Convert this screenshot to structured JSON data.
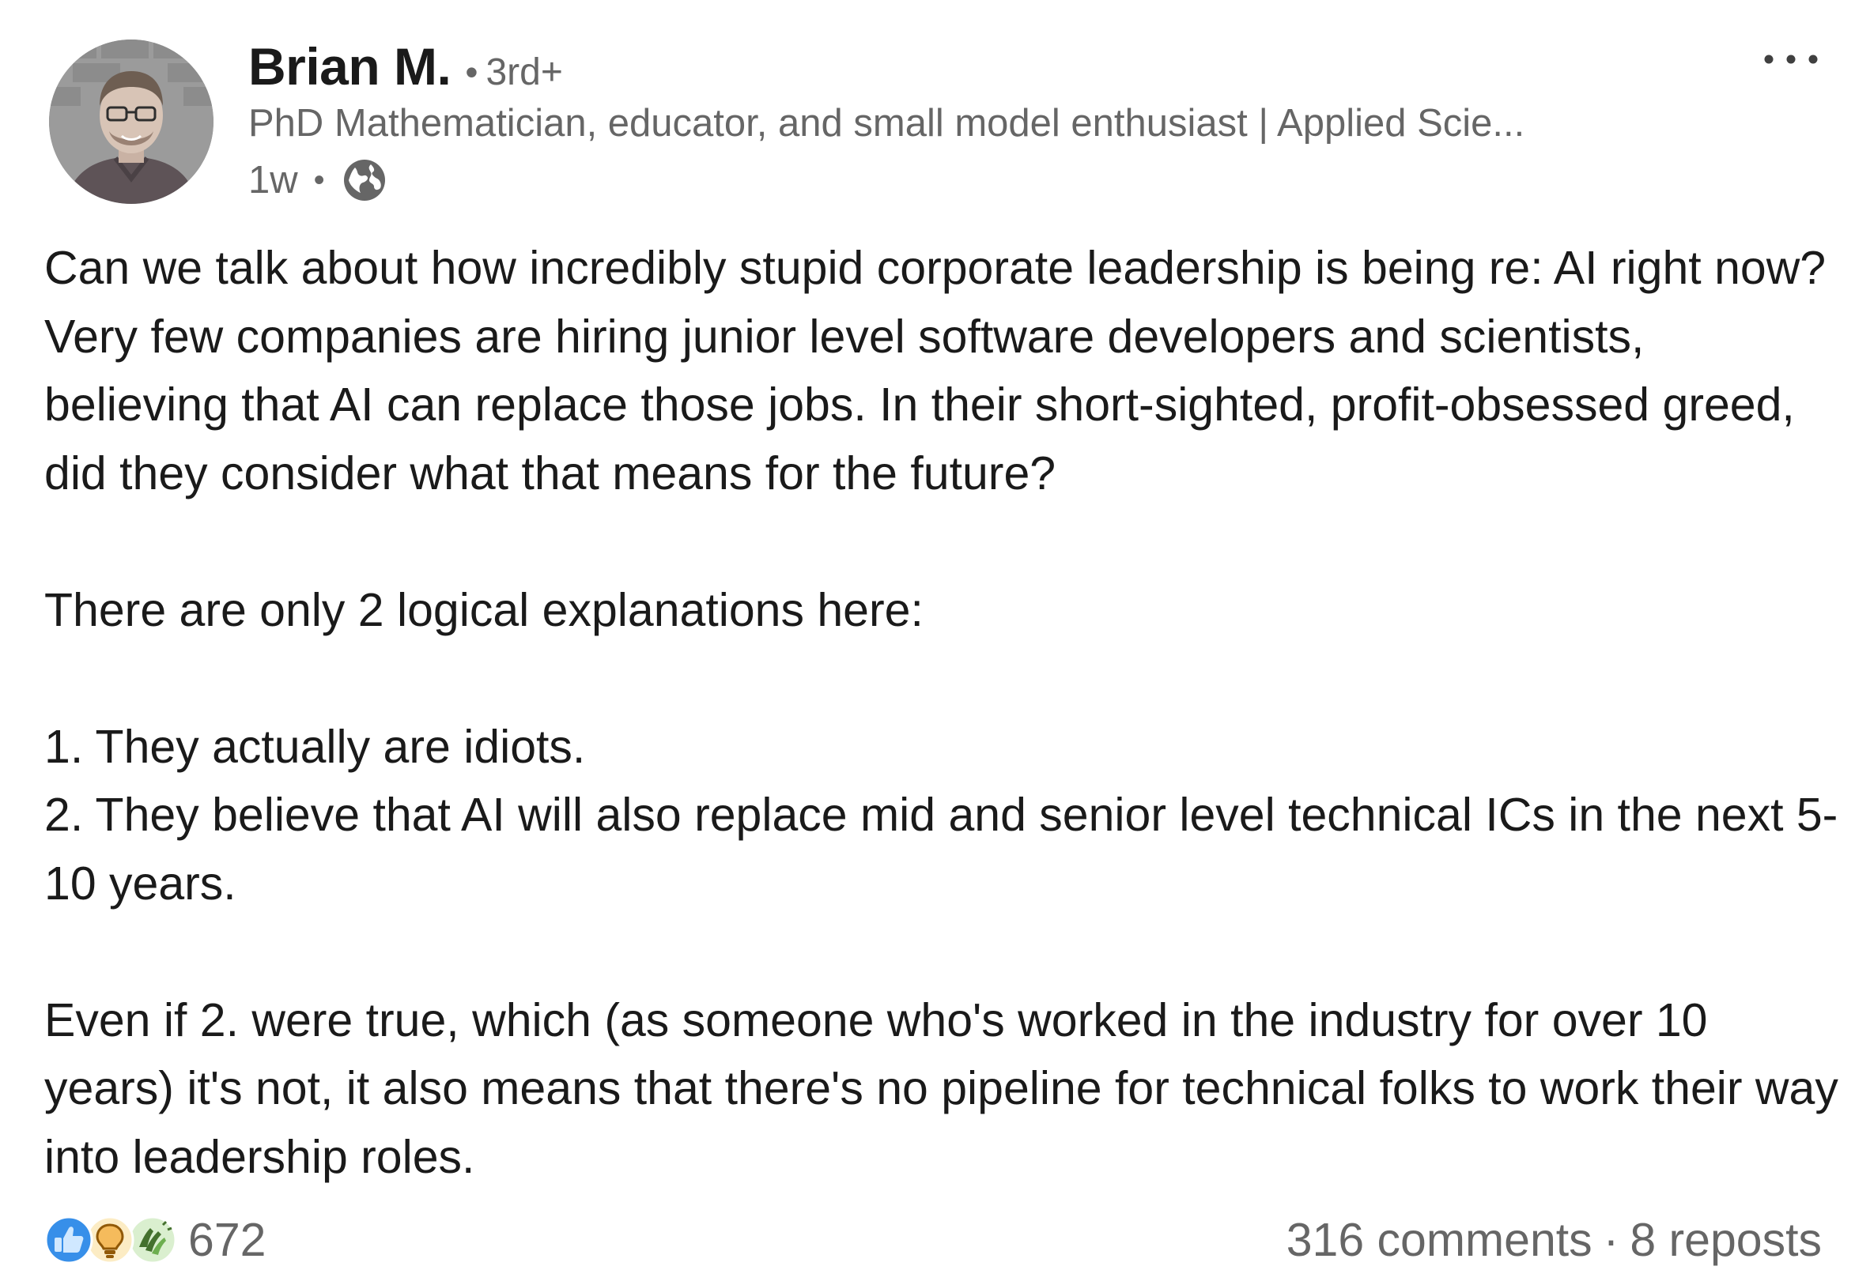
{
  "author": {
    "name": "Brian M.",
    "connection_degree": "3rd+",
    "headline": "PhD Mathematician, educator, and small model enthusiast | Applied Scie...",
    "posted_ago": "1w",
    "visibility_icon": "globe-icon"
  },
  "separators": {
    "dot": "•",
    "middot": "·"
  },
  "post": {
    "paragraphs": [
      "Can we talk about how incredibly stupid corporate leadership is being re: AI right now? Very few companies are hiring junior level software developers and scientists, believing that AI can replace those jobs. In their short-sighted, profit-obsessed greed, did they consider what that means for the future?",
      "There are only 2 logical explanations here:",
      "Even if 2. were true, which (as someone who's worked in the industry for over 10 years) it's not, it also means that there's no pipeline for technical folks to work their way into leadership roles."
    ],
    "list_items": [
      "1. They actually are idiots.",
      "2. They believe that AI will also replace mid and senior level technical ICs in the next 5-10 years."
    ]
  },
  "social": {
    "reaction_icons": [
      "like-icon",
      "insightful-icon",
      "celebrate-icon"
    ],
    "reaction_count": "672",
    "comments": "316 comments",
    "reposts": "8 reposts"
  },
  "colors": {
    "text_primary": "#1a1a1a",
    "text_secondary": "#666666",
    "like_blue": "#378fe9",
    "insightful_yellow": "#f5bb5c",
    "celebrate_green": "#44712e"
  }
}
